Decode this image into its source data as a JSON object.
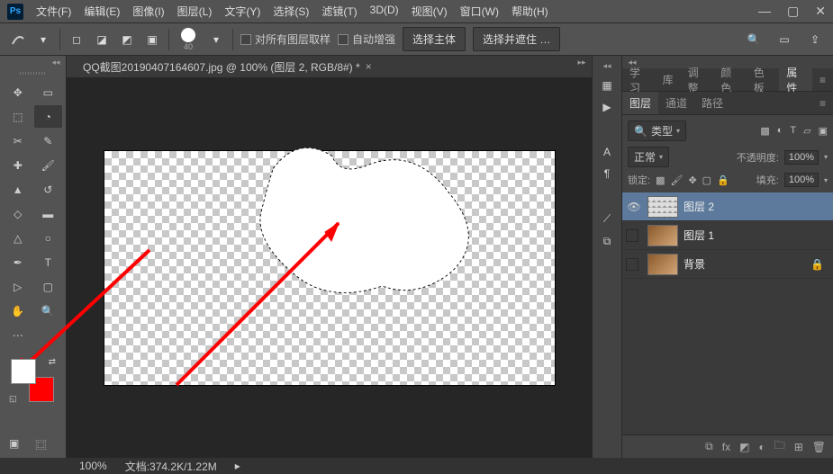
{
  "app": {
    "logo": "Ps",
    "title": "QQ截图20190407164607.jpg @ 100% (图层 2, RGB/8#) *"
  },
  "menu": [
    "文件(F)",
    "编辑(E)",
    "图像(I)",
    "图层(L)",
    "文字(Y)",
    "选择(S)",
    "滤镜(T)",
    "3D(D)",
    "视图(V)",
    "窗口(W)",
    "帮助(H)"
  ],
  "options": {
    "brush_size": "40",
    "cb1_label": "对所有图层取样",
    "cb2_label": "自动增强",
    "btn1": "选择主体",
    "btn2": "选择并遮住 …"
  },
  "panel_tabs1": [
    "学习",
    "库",
    "调整",
    "颜色",
    "色板",
    "属性"
  ],
  "panel_tabs2": [
    "图层",
    "通道",
    "路径"
  ],
  "layers_panel": {
    "kind": "类型",
    "blend_mode": "正常",
    "opacity_label": "不透明度:",
    "opacity_value": "100%",
    "lock_label": "锁定:",
    "fill_label": "填充:",
    "fill_value": "100%",
    "layers": [
      {
        "name": "图层 2",
        "visible": true,
        "selected": true,
        "locked": false,
        "thumb": "checker"
      },
      {
        "name": "图层 1",
        "visible": false,
        "selected": false,
        "locked": false,
        "thumb": "img"
      },
      {
        "name": "背景",
        "visible": false,
        "selected": false,
        "locked": true,
        "thumb": "img"
      }
    ]
  },
  "status": {
    "zoom": "100%",
    "doc_size": "文档:374.2K/1.22M"
  },
  "colors": {
    "foreground": "#ffffff",
    "background": "#ff0000"
  },
  "chart_data": null
}
